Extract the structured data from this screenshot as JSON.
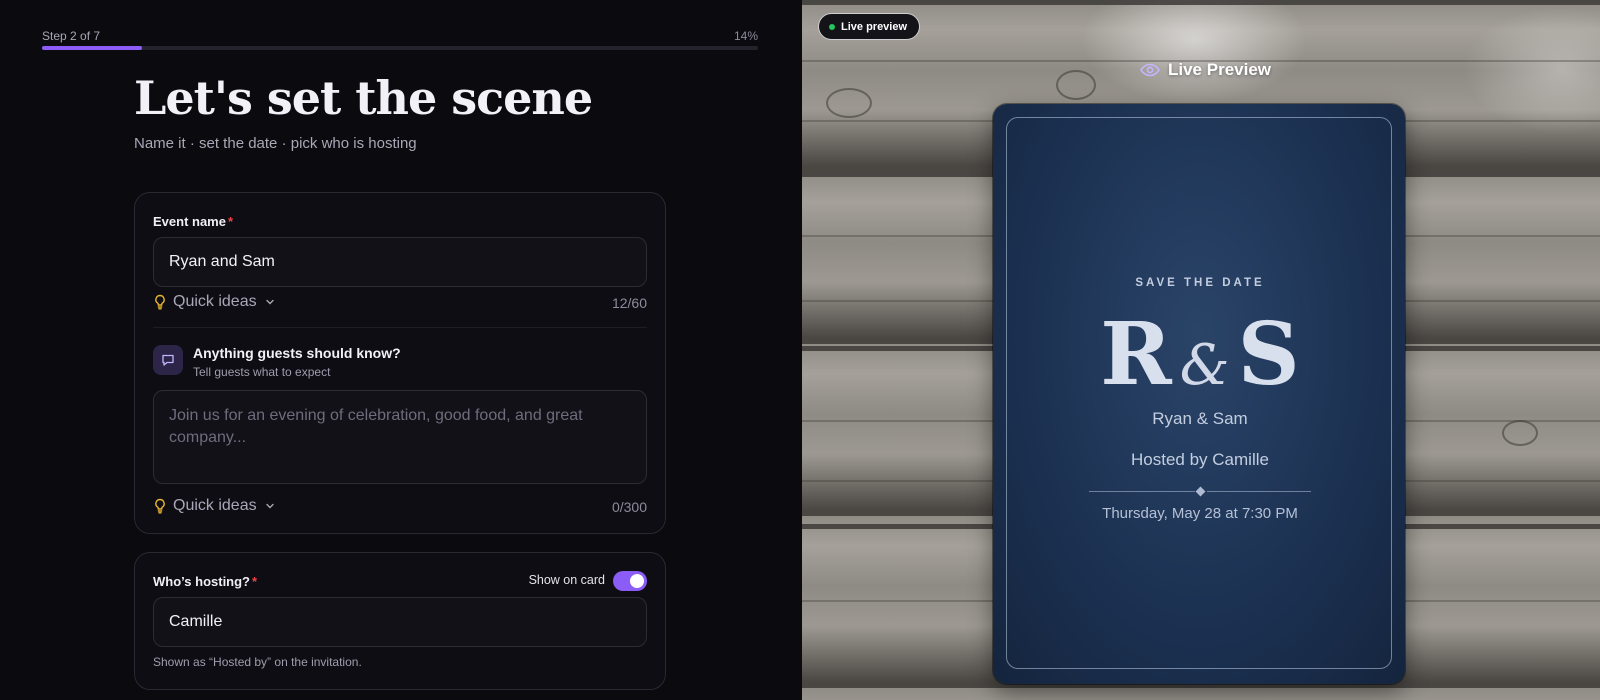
{
  "progress": {
    "step_label": "Step 2 of 7",
    "percent_label": "14%",
    "fraction": 0.14
  },
  "header": {
    "title": "Let's set the scene",
    "subtitle": "Name it · set the date · pick who is hosting"
  },
  "event_name": {
    "label": "Event name",
    "required_mark": "*",
    "value": "Ryan and Sam",
    "quick_ideas": "Quick ideas",
    "counter": "12/60"
  },
  "guests_note": {
    "title": "Anything guests should know?",
    "subtitle": "Tell guests what to expect",
    "placeholder": "Join us for an evening of celebration, good food, and great company...",
    "quick_ideas": "Quick ideas",
    "counter": "0/300"
  },
  "host": {
    "label": "Who’s hosting?",
    "required_mark": "*",
    "toggle_label": "Show on card",
    "toggle_on": true,
    "value": "Camille",
    "hint": "Shown as “Hosted by” on the invitation."
  },
  "preview": {
    "badge": "Live preview",
    "title": "Live Preview",
    "card": {
      "save_the_date": "SAVE THE DATE",
      "monogram_left": "R",
      "monogram_amp": "&",
      "monogram_right": "S",
      "names": "Ryan & Sam",
      "hosted": "Hosted by Camille",
      "when": "Thursday, May 28 at 7:30 PM"
    }
  },
  "colors": {
    "accent": "#8b5cf6",
    "required": "#ef4444",
    "live_dot": "#22c55e",
    "card_navy": "#1c3253"
  },
  "icons": [
    "lightbulb-icon",
    "chevron-down-icon",
    "message-square-icon",
    "eye-icon"
  ]
}
